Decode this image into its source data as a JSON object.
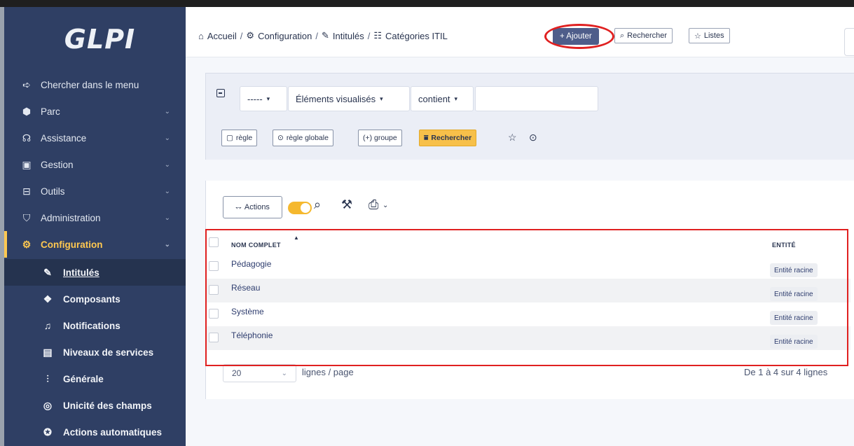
{
  "app": {
    "logo": "GLPI"
  },
  "sidebar": {
    "items": [
      {
        "label": "Chercher dans le menu",
        "icon": "arrow-right-icon"
      },
      {
        "label": "Parc",
        "icon": "cube-icon"
      },
      {
        "label": "Assistance",
        "icon": "headset-icon"
      },
      {
        "label": "Gestion",
        "icon": "wallet-icon"
      },
      {
        "label": "Outils",
        "icon": "briefcase-icon"
      },
      {
        "label": "Administration",
        "icon": "shield-icon"
      },
      {
        "label": "Configuration",
        "icon": "gear-icon"
      }
    ],
    "subitems": [
      {
        "label": "Intitulés",
        "icon": "edit-icon"
      },
      {
        "label": "Composants",
        "icon": "components-icon"
      },
      {
        "label": "Notifications",
        "icon": "bell-icon"
      },
      {
        "label": "Niveaux de services",
        "icon": "clipboard-icon"
      },
      {
        "label": "Générale",
        "icon": "sliders-icon"
      },
      {
        "label": "Unicité des champs",
        "icon": "fingerprint-icon"
      },
      {
        "label": "Actions automatiques",
        "icon": "gear-play-icon"
      }
    ]
  },
  "header": {
    "breadcrumb": [
      "Accueil",
      "Configuration",
      "Intitulés",
      "Catégories ITIL"
    ],
    "add_label": "+ Ajouter",
    "search_label": "Rechercher",
    "lists_label": "Listes"
  },
  "search": {
    "field_select": "-----",
    "criteria_select": "Éléments visualisés",
    "operator_select": "contient",
    "value_input": "",
    "rule_label": "règle",
    "global_rule_label": "règle globale",
    "group_label": "(+) groupe",
    "search_button": "Rechercher"
  },
  "results": {
    "actions_label": "Actions",
    "columns": {
      "name": "NOM COMPLET",
      "entity": "ENTITÉ"
    },
    "rows": [
      {
        "name": "Pédagogie",
        "entity": "Entité racine"
      },
      {
        "name": "Réseau",
        "entity": "Entité racine"
      },
      {
        "name": "Système",
        "entity": "Entité racine"
      },
      {
        "name": "Téléphonie",
        "entity": "Entité racine"
      }
    ],
    "per_page": "20",
    "per_page_label": "lignes / page",
    "pagination_info": "De 1 à 4 sur 4 lignes"
  }
}
